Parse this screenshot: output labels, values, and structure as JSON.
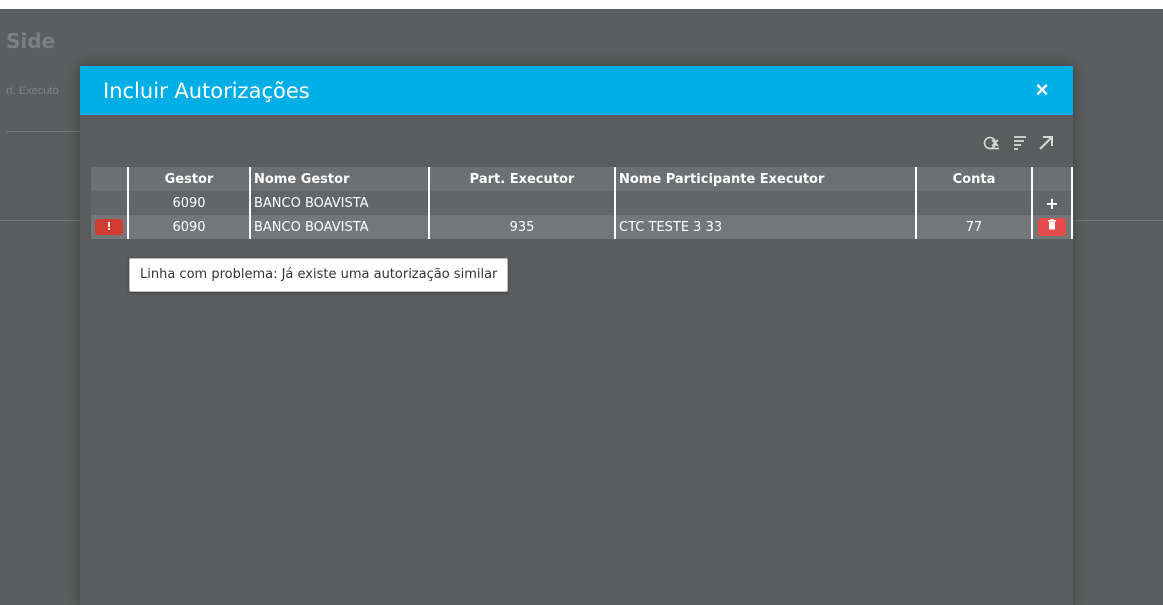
{
  "background": {
    "title": "Side",
    "field_label": "rt. Executo"
  },
  "modal": {
    "title": "Incluir Autorizações",
    "close_icon": "×",
    "header_color": "#00aee6",
    "toolbar": [
      "clear-filter-icon",
      "sort-lines-icon",
      "expand-arrow-icon"
    ]
  },
  "table": {
    "columns": [
      "",
      "Gestor",
      "Nome Gestor",
      "Part. Executor",
      "Nome Participante Executor",
      "Conta",
      ""
    ],
    "rows": [
      {
        "gestor": "6090",
        "nome_gestor": "BANCO BOAVISTA",
        "part_executor": "",
        "nome_participante": "",
        "conta": "",
        "action": "+"
      },
      {
        "error": "!",
        "gestor": "6090",
        "nome_gestor": "BANCO BOAVISTA",
        "part_executor": "935",
        "nome_participante": "CTC TESTE 3 33",
        "conta": "77",
        "action": "trash-icon"
      }
    ]
  },
  "tooltip": {
    "text": "Linha com problema: Já existe uma autorização similar"
  },
  "colors": {
    "error": "#d23b32",
    "delete": "#e54b4b"
  }
}
